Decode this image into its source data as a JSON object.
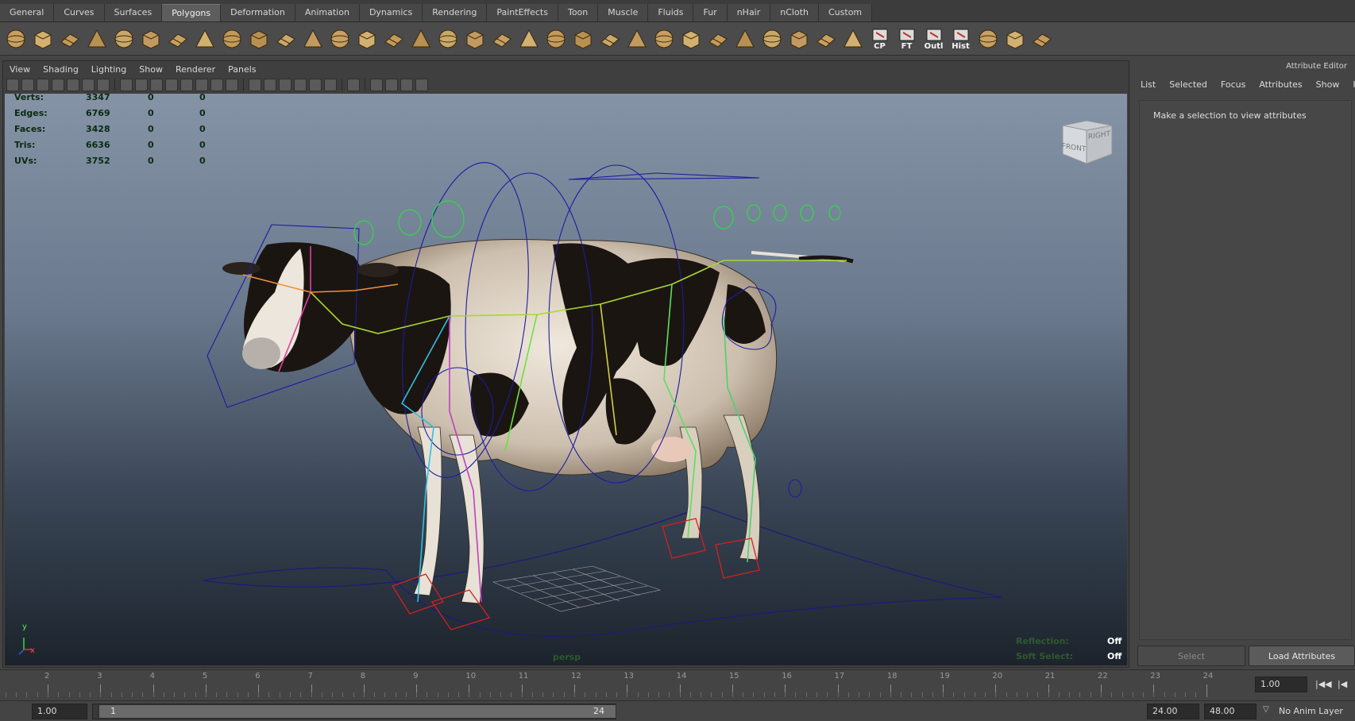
{
  "shelf": {
    "tabs": [
      "General",
      "Curves",
      "Surfaces",
      "Polygons",
      "Deformation",
      "Animation",
      "Dynamics",
      "Rendering",
      "PaintEffects",
      "Toon",
      "Muscle",
      "Fluids",
      "Fur",
      "nHair",
      "nCloth",
      "Custom"
    ],
    "active_tab": "Polygons",
    "icons": [
      {
        "name": "poly-sphere-icon"
      },
      {
        "name": "poly-cube-icon"
      },
      {
        "name": "poly-cylinder-icon"
      },
      {
        "name": "poly-cone-icon"
      },
      {
        "name": "poly-plane-icon"
      },
      {
        "name": "poly-torus-icon"
      },
      {
        "name": "poly-pyramid-icon"
      },
      {
        "name": "poly-pipe-icon"
      },
      {
        "name": "poly-soccer-ball-icon"
      },
      {
        "name": "combine-icon"
      },
      {
        "name": "separate-icon"
      },
      {
        "name": "smooth-icon"
      },
      {
        "name": "bevel-box-icon"
      },
      {
        "name": "extrude-face-icon"
      },
      {
        "name": "split-polygon-icon"
      },
      {
        "name": "insert-edge-loop-icon"
      },
      {
        "name": "extrude-icon"
      },
      {
        "name": "bridge-icon"
      },
      {
        "name": "append-polygon-icon"
      },
      {
        "name": "make-hole-icon"
      },
      {
        "name": "fill-hole-icon"
      },
      {
        "name": "poke-face-icon"
      },
      {
        "name": "wedge-face-icon"
      },
      {
        "name": "duplicate-face-icon"
      },
      {
        "name": "merge-vertex-icon"
      },
      {
        "name": "cut-faces-icon"
      },
      {
        "name": "sculpt-icon"
      },
      {
        "name": "planar-mapping-icon"
      },
      {
        "name": "cylindrical-mapping-icon"
      },
      {
        "name": "spherical-mapping-icon"
      },
      {
        "name": "automatic-mapping-icon"
      },
      {
        "name": "uv-editor-icon"
      },
      {
        "name": "cp-icon",
        "label": "CP"
      },
      {
        "name": "ft-icon",
        "label": "FT"
      },
      {
        "name": "outliner-icon",
        "label": "Outl"
      },
      {
        "name": "history-icon",
        "label": "Hist"
      },
      {
        "name": "paint-uv-icon"
      },
      {
        "name": "transfer-icon"
      },
      {
        "name": "texture-icon"
      }
    ]
  },
  "viewport": {
    "menu": [
      "View",
      "Shading",
      "Lighting",
      "Show",
      "Renderer",
      "Panels"
    ],
    "camera": "persp",
    "stats": [
      {
        "label": "Verts:",
        "v0": "3347",
        "v1": "0",
        "v2": "0"
      },
      {
        "label": "Edges:",
        "v0": "6769",
        "v1": "0",
        "v2": "0"
      },
      {
        "label": "Faces:",
        "v0": "3428",
        "v1": "0",
        "v2": "0"
      },
      {
        "label": "Tris:",
        "v0": "6636",
        "v1": "0",
        "v2": "0"
      },
      {
        "label": "UVs:",
        "v0": "3752",
        "v1": "0",
        "v2": "0"
      }
    ],
    "reflection_label": "Reflection:",
    "reflection_value": "Off",
    "soft_select_label": "Soft Select:",
    "soft_select_value": "Off",
    "cube_front": "FRONT",
    "cube_right": "RIGHT",
    "axis_y": "y",
    "axis_x": "x"
  },
  "attribute_editor": {
    "title": "Attribute Editor",
    "menu": [
      "List",
      "Selected",
      "Focus",
      "Attributes",
      "Show",
      "Help"
    ],
    "message": "Make a selection to view attributes",
    "select_button": "Select",
    "load_button": "Load Attributes"
  },
  "time_slider": {
    "ticks": [
      "2",
      "3",
      "4",
      "5",
      "6",
      "7",
      "8",
      "9",
      "10",
      "11",
      "12",
      "13",
      "14",
      "15",
      "16",
      "17",
      "18",
      "19",
      "20",
      "21",
      "22",
      "23",
      "24"
    ],
    "current_time": "1.00"
  },
  "range_slider": {
    "start": "1.00",
    "handle_start": "1",
    "handle_end": "24",
    "end": "24.00",
    "anim_end": "48.00",
    "anim_layer": "No Anim Layer"
  },
  "colors": {
    "viewport_top": "#8593a6",
    "viewport_bottom": "#1c232c",
    "hud_text": "#0a2a10"
  }
}
